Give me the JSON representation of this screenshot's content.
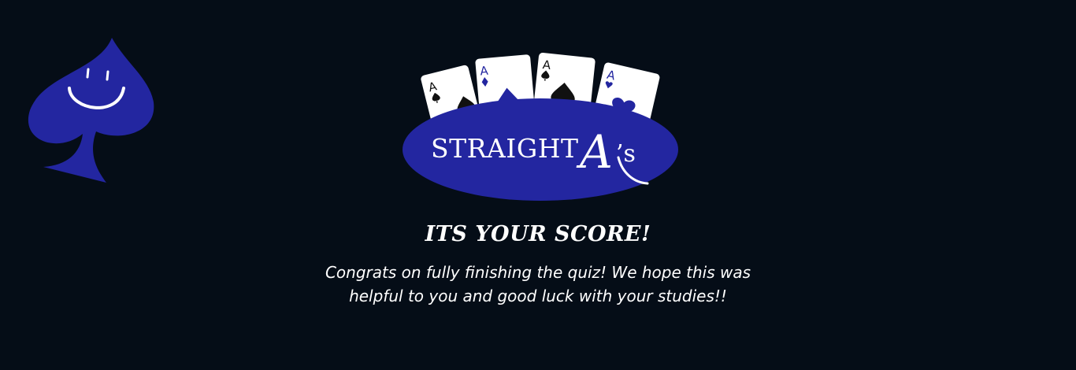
{
  "mascot": {
    "icon": "smiling-spade-icon",
    "color": "#2326a0"
  },
  "logo": {
    "card_rank": "A",
    "card_suits": [
      "spade-icon",
      "diamond-icon",
      "spade-icon",
      "heart-icon"
    ],
    "wordmark": "STRAIGHT",
    "letter": "A",
    "suffix": "’s",
    "oval_color": "#2326a0"
  },
  "result": {
    "heading": "ITS YOUR SCORE!",
    "message": "Congrats on fully finishing the quiz! We hope this was helpful to you and good luck with your studies!!"
  },
  "theme": {
    "background": "#050d17",
    "accent": "#2326a0",
    "text": "#ffffff"
  }
}
